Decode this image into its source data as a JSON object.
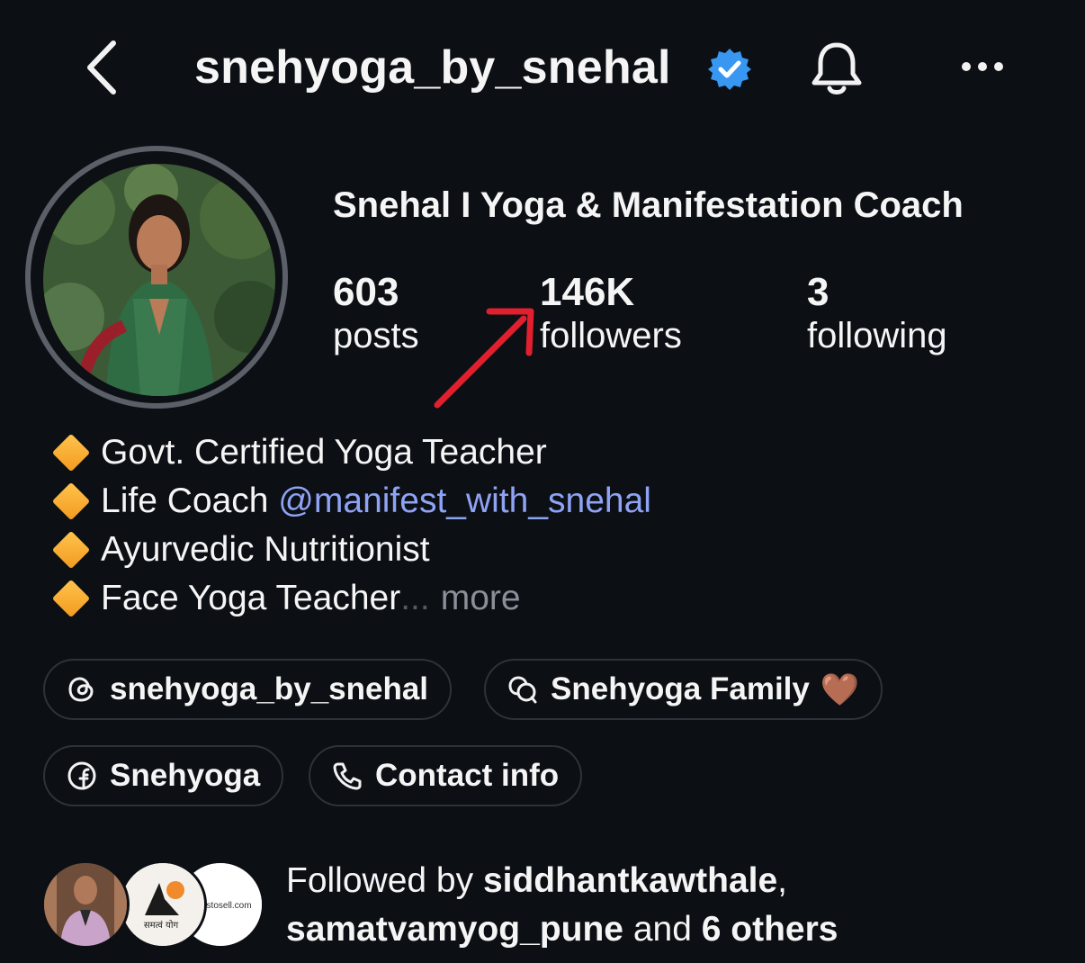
{
  "header": {
    "username": "snehyoga_by_snehal",
    "back_icon": "chevron-left-icon",
    "verified_icon": "verified-badge-icon",
    "bell_icon": "bell-icon",
    "more_icon": "more-dots-icon"
  },
  "profile": {
    "display_name": "Snehal  I Yoga & Manifestation Coach",
    "stats": [
      {
        "value": "603",
        "label": "posts"
      },
      {
        "value": "146K",
        "label": "followers"
      },
      {
        "value": "3",
        "label": "following"
      }
    ]
  },
  "bio": {
    "lines": [
      "Govt. Certified Yoga Teacher",
      "Life Coach ",
      "Ayurvedic Nutritionist",
      "Face Yoga Teacher"
    ],
    "mention": "@manifest_with_snehal",
    "ellipsis": "...",
    "more_label": "more"
  },
  "links": {
    "threads": {
      "label": "snehyoga_by_snehal",
      "icon": "threads-icon"
    },
    "channel": {
      "label": "Snehyoga Family",
      "icon": "chat-bubbles-icon",
      "emoji": "🤎"
    },
    "facebook": {
      "label": "Snehyoga",
      "icon": "facebook-icon"
    },
    "contact": {
      "label": "Contact info",
      "icon": "phone-icon"
    }
  },
  "followed_by": {
    "prefix": "Followed by ",
    "user1": "siddhantkawthale",
    "comma": ",",
    "user2": "samatvamyog_pune",
    "middle": " and ",
    "others": "6 others",
    "avatar2_text": "समत्वं योग",
    "avatar3_text": "adstosell.com"
  },
  "colors": {
    "background": "#0c0f14",
    "mention": "#8fa3f5",
    "verified": "#3897f0",
    "annotation_arrow": "#e0202e"
  }
}
